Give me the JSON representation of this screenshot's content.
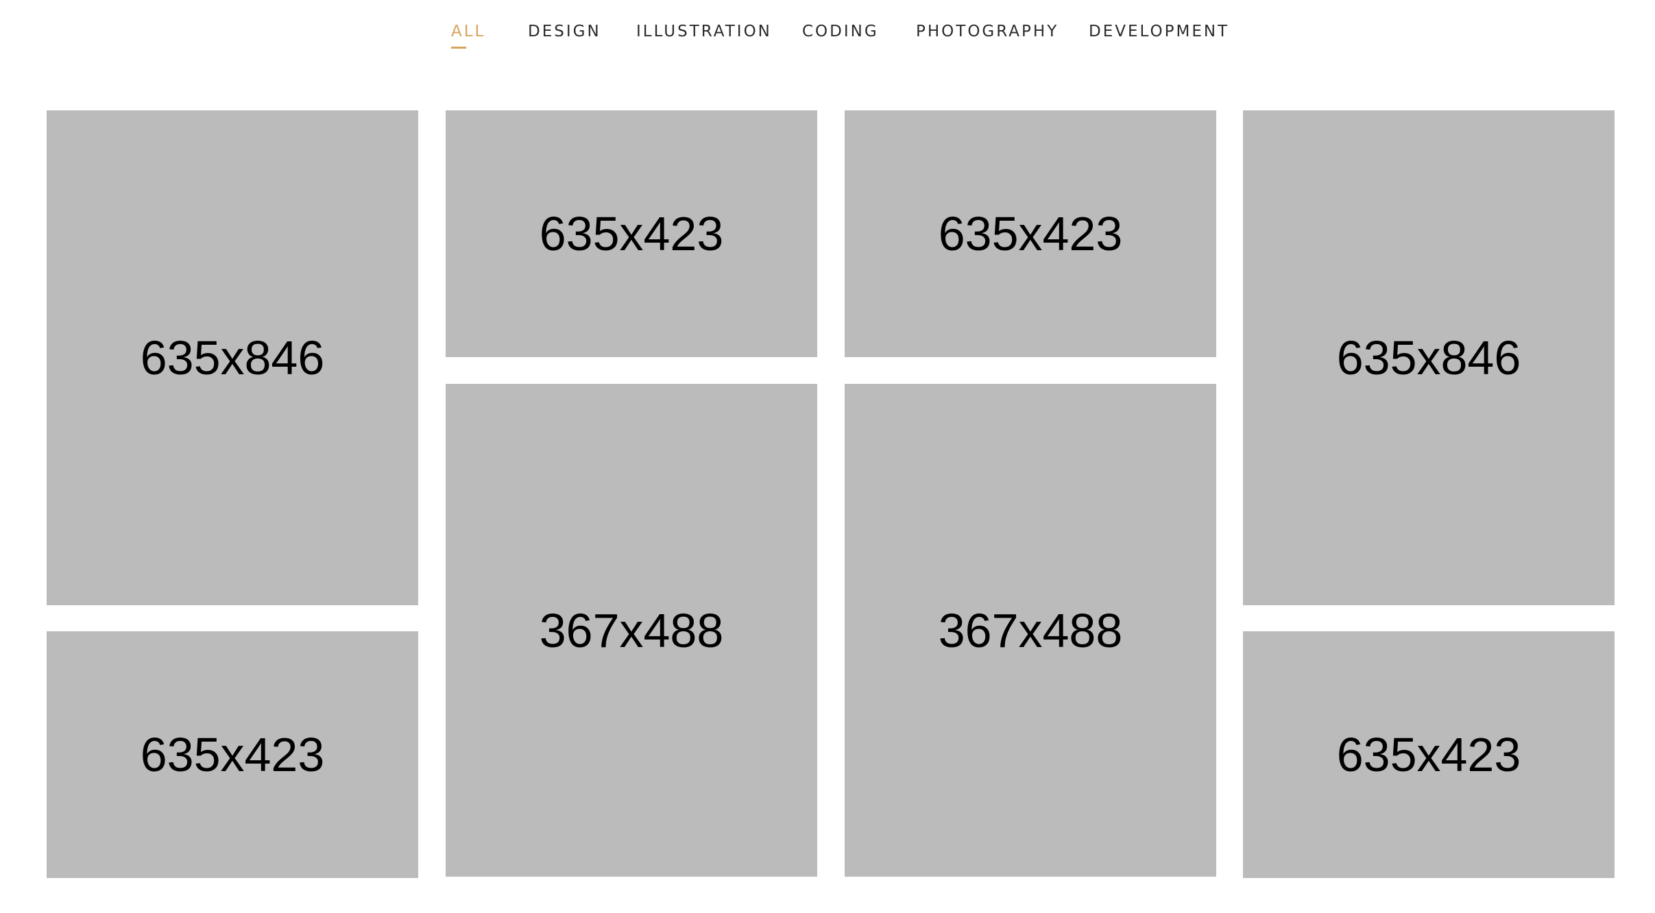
{
  "filters": [
    {
      "label": "ALL",
      "active": true
    },
    {
      "label": "DESIGN",
      "active": false
    },
    {
      "label": "ILLUSTRATION",
      "active": false
    },
    {
      "label": "CODING",
      "active": false
    },
    {
      "label": "PHOTOGRAPHY",
      "active": false
    },
    {
      "label": "DEVELOPMENT",
      "active": false
    }
  ],
  "tiles": [
    {
      "label": "635x846"
    },
    {
      "label": "635x423"
    },
    {
      "label": "635x423"
    },
    {
      "label": "635x846"
    },
    {
      "label": "635x423"
    },
    {
      "label": "367x488"
    },
    {
      "label": "367x488"
    },
    {
      "label": "635x423"
    }
  ],
  "colors": {
    "accent": "#d8a35c",
    "text": "#2a2a2a",
    "placeholder_bg": "#bbbbbb",
    "placeholder_text": "#000000"
  }
}
